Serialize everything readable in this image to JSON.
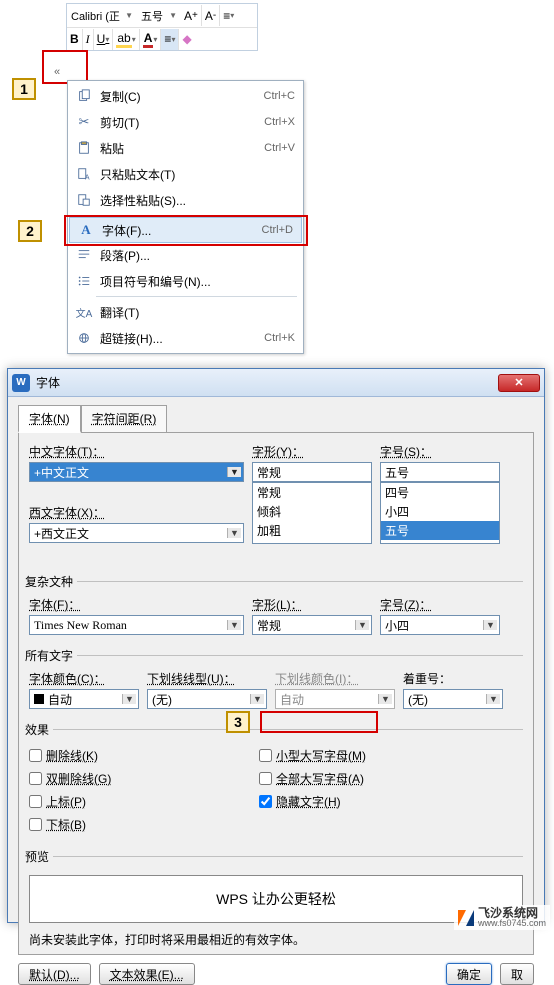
{
  "toolbar": {
    "font_name": "Calibri (正",
    "font_size": "五号",
    "btn_bold": "B",
    "btn_italic": "I",
    "btn_under": "U"
  },
  "steps": {
    "s1": "1",
    "s2": "2",
    "s3": "3"
  },
  "context_menu": {
    "copy": {
      "label": "复制(C)",
      "shortcut": "Ctrl+C"
    },
    "cut": {
      "label": "剪切(T)",
      "shortcut": "Ctrl+X"
    },
    "paste": {
      "label": "粘贴",
      "shortcut": "Ctrl+V"
    },
    "paste_text": {
      "label": "只粘贴文本(T)"
    },
    "paste_special": {
      "label": "选择性粘贴(S)..."
    },
    "font": {
      "label": "字体(F)...",
      "shortcut": "Ctrl+D"
    },
    "paragraph": {
      "label": "段落(P)..."
    },
    "bullets": {
      "label": "项目符号和编号(N)..."
    },
    "translate": {
      "label": "翻译(T)"
    },
    "hyperlink": {
      "label": "超链接(H)...",
      "shortcut": "Ctrl+K"
    }
  },
  "dialog": {
    "title": "字体",
    "tabs": {
      "font": "字体(N)",
      "advanced": "字符间距(R)"
    },
    "zh_font_lbl": "中文字体(T)：",
    "zh_font_val": "+中文正文",
    "style_lbl": "字形(Y)：",
    "style_val": "常规",
    "style_opts": [
      "常规",
      "倾斜",
      "加粗"
    ],
    "size_lbl": "字号(S)：",
    "size_val": "五号",
    "size_opts": [
      "四号",
      "小四",
      "五号"
    ],
    "west_font_lbl": "西文字体(X)：",
    "west_font_val": "+西文正文",
    "complex_legend": "复杂文种",
    "cx_font_lbl": "字体(F)：",
    "cx_font_val": "Times New Roman",
    "cx_style_lbl": "字形(L)：",
    "cx_style_val": "常规",
    "cx_size_lbl": "字号(Z)：",
    "cx_size_val": "小四",
    "all_text_legend": "所有文字",
    "color_lbl": "字体颜色(C)：",
    "color_val": "自动",
    "ul_style_lbl": "下划线线型(U)：",
    "ul_style_val": "(无)",
    "ul_color_lbl": "下划线颜色(I)：",
    "ul_color_val": "自动",
    "emphasis_lbl": "着重号：",
    "emphasis_val": "(无)",
    "effects_legend": "效果",
    "chk_strike": "删除线(K)",
    "chk_dblstrike": "双删除线(G)",
    "chk_sup": "上标(P)",
    "chk_sub": "下标(B)",
    "chk_smallcaps": "小型大写字母(M)",
    "chk_allcaps": "全部大写字母(A)",
    "chk_hidden": "隐藏文字(H)",
    "preview_legend": "预览",
    "preview_text": "WPS 让办公更轻松",
    "note": "尚未安装此字体，打印时将采用最相近的有效字体。",
    "btn_default": "默认(D)...",
    "btn_texteffect": "文本效果(E)...",
    "btn_ok": "确定",
    "btn_cancel": "取"
  },
  "watermark": {
    "t1": "飞沙系统网",
    "t2": "www.fs0745.com"
  }
}
